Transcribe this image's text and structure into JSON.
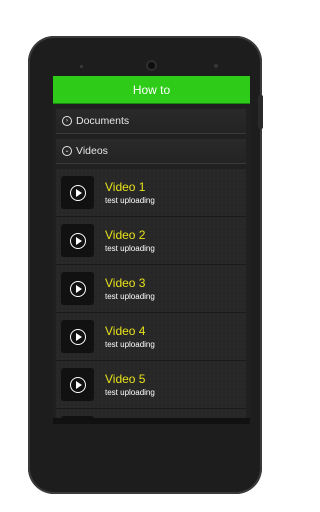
{
  "header": {
    "title": "How to"
  },
  "sections": [
    {
      "label": "Documents",
      "state": "collapsed",
      "icon": "chevron-right-circle-icon"
    },
    {
      "label": "Videos",
      "state": "expanded",
      "icon": "chevron-down-circle-icon"
    }
  ],
  "videos": [
    {
      "title": "Video 1",
      "subtitle": "test uploading"
    },
    {
      "title": "Video 2",
      "subtitle": "test uploading"
    },
    {
      "title": "Video 3",
      "subtitle": "test uploading"
    },
    {
      "title": "Video 4",
      "subtitle": "test uploading"
    },
    {
      "title": "Video 5",
      "subtitle": "test uploading"
    }
  ],
  "colors": {
    "accent": "#2ecc18",
    "video_title": "#e8e21a",
    "background": "#202020"
  }
}
